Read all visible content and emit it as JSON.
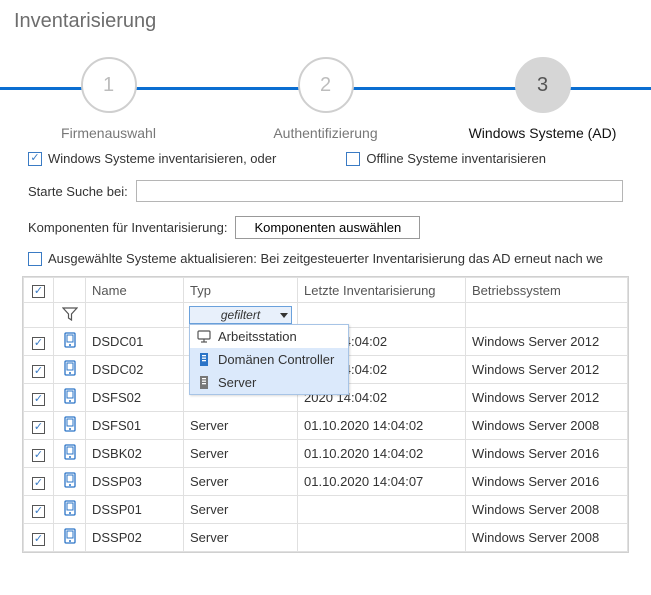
{
  "title": "Inventarisierung",
  "stepper": {
    "steps": [
      {
        "num": "1",
        "label": "Firmenauswahl"
      },
      {
        "num": "2",
        "label": "Authentifizierung"
      },
      {
        "num": "3",
        "label": "Windows Systeme (AD)"
      }
    ],
    "active_index": 2
  },
  "options": {
    "inventory_windows": {
      "label": "Windows Systeme inventarisieren, oder",
      "checked": true
    },
    "inventory_offline": {
      "label": "Offline Systeme inventarisieren",
      "checked": false
    }
  },
  "search": {
    "label": "Starte Suche bei:",
    "value": ""
  },
  "components": {
    "label": "Komponenten für Inventarisierung:",
    "button": "Komponenten auswählen"
  },
  "update_selected": {
    "label": "Ausgewählte Systeme aktualisieren: Bei zeitgesteuerter Inventarisierung das AD erneut nach we",
    "checked": false
  },
  "table": {
    "headers": {
      "name": "Name",
      "type": "Typ",
      "last": "Letzte Inventarisierung",
      "os": "Betriebssystem"
    },
    "filter": {
      "type_combo": "gefiltert"
    },
    "rows": [
      {
        "checked": true,
        "name": "DSDC01",
        "type": "Domänen Controller",
        "date": "01.10.2020 14:04:02",
        "os": "Windows Server 2012"
      },
      {
        "checked": true,
        "name": "DSDC02",
        "type": "Domänen Controller",
        "date": "01.10.2020 14:04:02",
        "os": "Windows Server 2012"
      },
      {
        "checked": true,
        "name": "DSFS02",
        "type": "Server",
        "date": "01.10.2020 14:04:02",
        "os": "Windows Server 2012"
      },
      {
        "checked": true,
        "name": "DSFS01",
        "type": "Server",
        "date": "01.10.2020 14:04:02",
        "os": "Windows Server 2008"
      },
      {
        "checked": true,
        "name": "DSBK02",
        "type": "Server",
        "date": "01.10.2020 14:04:02",
        "os": "Windows Server 2016"
      },
      {
        "checked": true,
        "name": "DSSP03",
        "type": "Server",
        "date": "01.10.2020 14:04:07",
        "os": "Windows Server 2016"
      },
      {
        "checked": true,
        "name": "DSSP01",
        "type": "Server",
        "date": "",
        "os": "Windows Server 2008"
      },
      {
        "checked": true,
        "name": "DSSP02",
        "type": "Server",
        "date": "",
        "os": "Windows Server 2008"
      }
    ]
  },
  "dropdown": {
    "items": [
      {
        "icon": "workstation",
        "label": "Arbeitsstation",
        "selected": false
      },
      {
        "icon": "dc",
        "label": "Domänen Controller",
        "selected": true
      },
      {
        "icon": "server",
        "label": "Server",
        "selected": true
      }
    ]
  },
  "overlay_cover_rows": 3
}
